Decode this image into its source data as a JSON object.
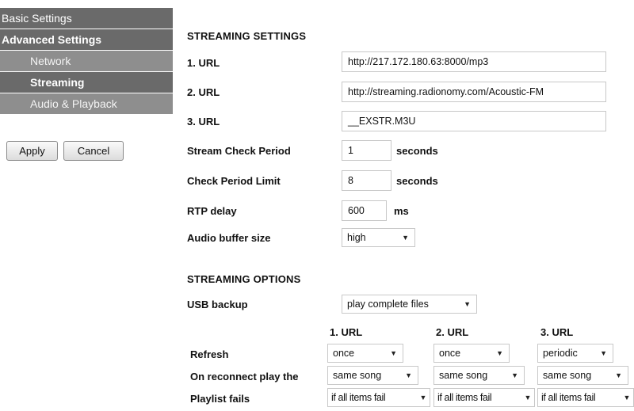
{
  "sidebar": {
    "items": [
      {
        "label": "Basic Settings"
      },
      {
        "label": "Advanced Settings"
      },
      {
        "label": "Network"
      },
      {
        "label": "Streaming"
      },
      {
        "label": "Audio & Playback"
      }
    ],
    "apply_label": "Apply",
    "cancel_label": "Cancel"
  },
  "streaming_settings": {
    "heading": "STREAMING SETTINGS",
    "url1_label": "1. URL",
    "url1_value": "http://217.172.180.63:8000/mp3",
    "url2_label": "2. URL",
    "url2_value": "http://streaming.radionomy.com/Acoustic-FM",
    "url3_label": "3. URL",
    "url3_value": "__EXSTR.M3U",
    "stream_check_label": "Stream Check Period",
    "stream_check_value": "1",
    "stream_check_unit": "seconds",
    "check_limit_label": "Check Period Limit",
    "check_limit_value": "8",
    "check_limit_unit": "seconds",
    "rtp_delay_label": "RTP delay",
    "rtp_delay_value": "600",
    "rtp_delay_unit": "ms",
    "audio_buffer_label": "Audio buffer size",
    "audio_buffer_value": "high"
  },
  "streaming_options": {
    "heading": "STREAMING OPTIONS",
    "usb_backup_label": "USB backup",
    "usb_backup_value": "play complete files",
    "columns": [
      "1. URL",
      "2. URL",
      "3. URL"
    ],
    "refresh_label": "Refresh",
    "refresh_values": [
      "once",
      "once",
      "periodic"
    ],
    "reconnect_label": "On reconnect play the",
    "reconnect_values": [
      "same song",
      "same song",
      "same song"
    ],
    "playlist_label": "Playlist fails",
    "playlist_values": [
      "if all items fail",
      "if all items fail",
      "if all items fail"
    ]
  },
  "colors": {
    "nav_dark": "#6a6a6a",
    "nav_light": "#8e8e8e"
  }
}
